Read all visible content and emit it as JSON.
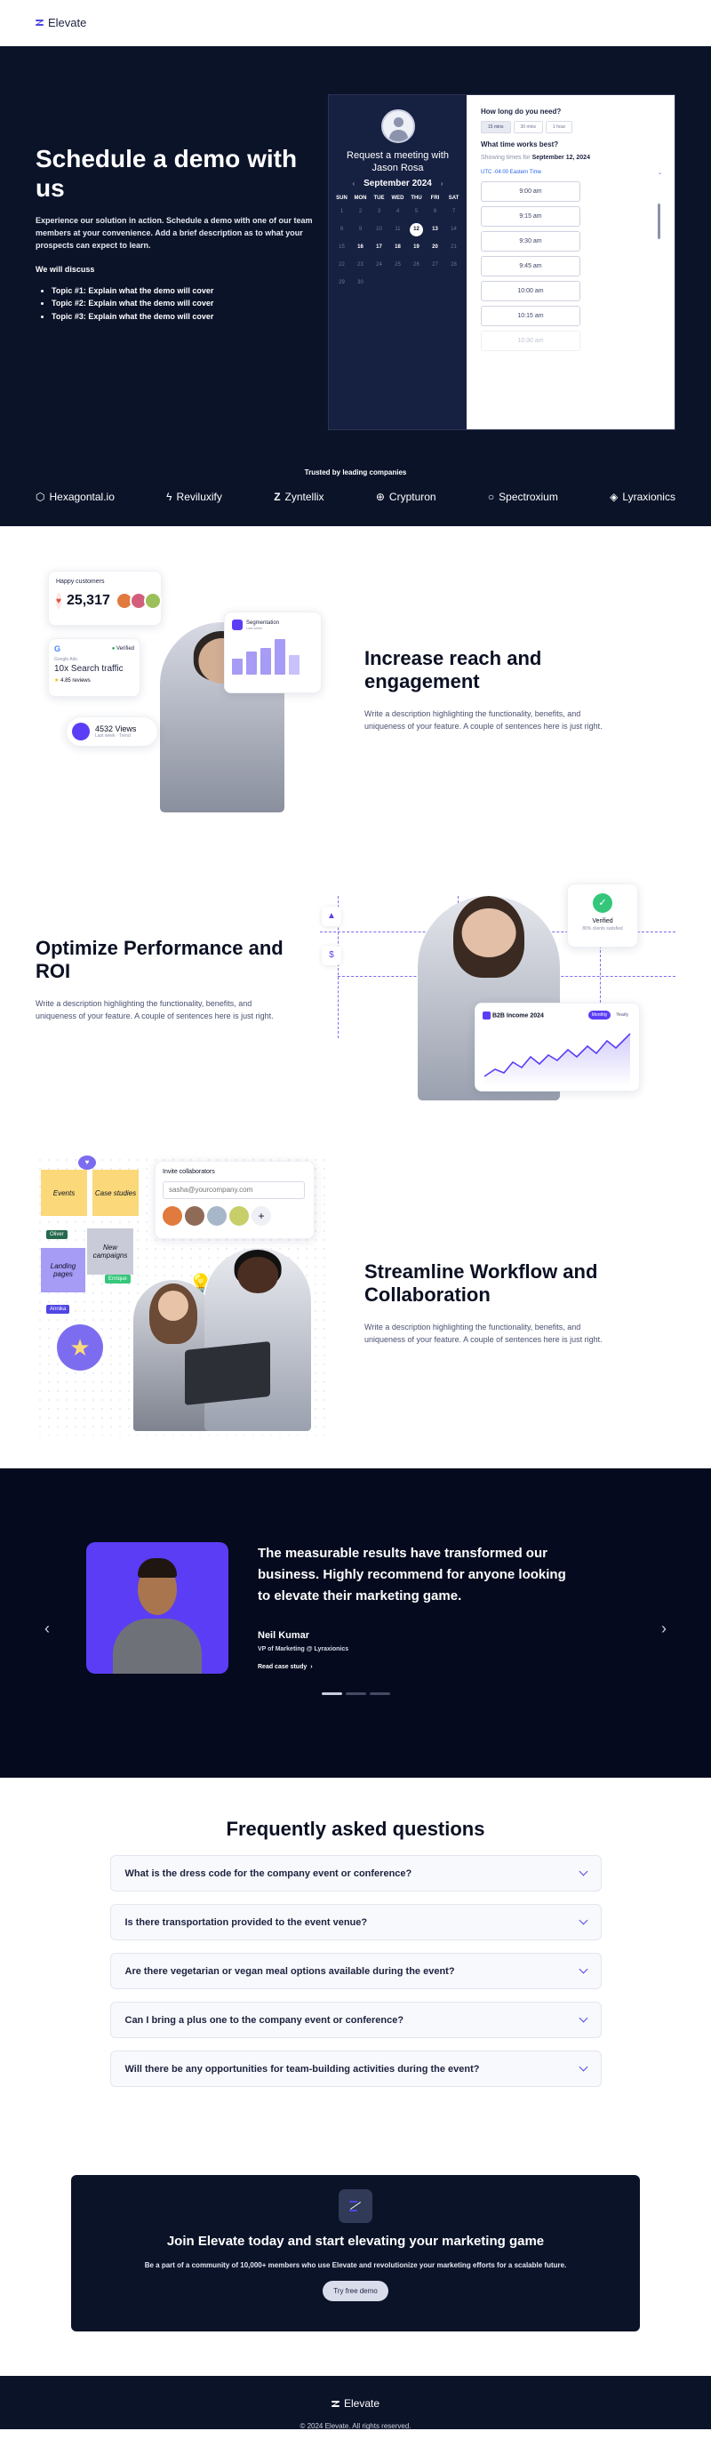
{
  "brand": {
    "name": "Elevate"
  },
  "hero": {
    "title": "Schedule a demo with us",
    "description": "Experience our solution in action. Schedule a demo with one of our team members at your convenience. Add a brief description as to what your prospects can expect to learn.",
    "discuss_heading": "We will discuss",
    "topics": [
      "Topic #1: Explain what the demo will cover",
      "Topic #2: Explain what the demo will cover",
      "Topic #3: Explain what the demo will cover"
    ]
  },
  "booking": {
    "request_title": "Request a meeting with Jason Rosa",
    "month": "September 2024",
    "weekdays": [
      "SUN",
      "MON",
      "TUE",
      "WED",
      "THU",
      "FRI",
      "SAT"
    ],
    "selected_day": "12",
    "duration_question": "How long do you need?",
    "durations": [
      "15 mins",
      "30 mins",
      "1 hour"
    ],
    "time_question": "What time works best?",
    "showing_prefix": "Showing times for",
    "showing_date": "September 12, 2024",
    "timezone": "UTC -04:00 Eastern Time",
    "times": [
      "9:00 am",
      "9:15 am",
      "9:30 am",
      "9:45 am",
      "10:00 am",
      "10:15 am",
      "10:30 am"
    ]
  },
  "trusted": {
    "label": "Trusted by leading companies",
    "logos": [
      {
        "name": "Hexagontal.io",
        "icon": "hexagon-icon"
      },
      {
        "name": "Reviluxify",
        "icon": "bolt-icon"
      },
      {
        "name": "Zyntellix",
        "icon": "z-icon"
      },
      {
        "name": "Crypturon",
        "icon": "plus-circle-icon"
      },
      {
        "name": "Spectroxium",
        "icon": "ring-icon"
      },
      {
        "name": "Lyraxionics",
        "icon": "diamond-icon"
      }
    ]
  },
  "feature1": {
    "title": "Increase reach and engagement",
    "description": "Write a description highlighting the functionality, benefits, and uniqueness of your feature. A couple of sentences here is just right.",
    "happy_label": "Happy customers",
    "happy_count": "25,317",
    "segmentation_label": "Segmentation",
    "segmentation_sub": "Last week",
    "google_sub": "Google Ads",
    "verified": "Verified",
    "traffic": "10x Search traffic",
    "reviews": "4.85 reviews",
    "views": "4532 Views",
    "views_sub": "Last week · Trend"
  },
  "feature2": {
    "title": "Optimize Performance and ROI",
    "description": "Write a description highlighting the functionality, benefits, and uniqueness of your feature. A couple of sentences here is just right.",
    "verified": "Verified",
    "verified_sub": "80% clients satisfied",
    "chart_title": "B2B Income 2024",
    "tab_monthly": "Monthly",
    "tab_yearly": "Yearly"
  },
  "feature3": {
    "title": "Streamline Workflow and Collaboration",
    "description": "Write a description highlighting the functionality, benefits, and uniqueness of your feature. A couple of sentences here is just right.",
    "invite_label": "Invite collaborators",
    "invite_placeholder": "sasha@yourcompany.com",
    "notes": [
      "Events",
      "Case studies",
      "New campaigns",
      "Landing pages"
    ],
    "tags": [
      "Oliver",
      "Enrique",
      "Annika"
    ]
  },
  "testimonial": {
    "quote": "The measurable results have transformed our business. Highly recommend for anyone looking to elevate their marketing game.",
    "name": "Neil Kumar",
    "role": "VP of Marketing @ Lyraxionics",
    "link": "Read case study"
  },
  "faq": {
    "title": "Frequently asked questions",
    "items": [
      "What is the dress code for the company event or conference?",
      "Is there transportation provided to the event venue?",
      "Are there vegetarian or vegan meal options available during the event?",
      "Can I bring a plus one to the company event or conference?",
      "Will there be any opportunities for team-building activities during the event?"
    ]
  },
  "cta": {
    "title": "Join Elevate today and start elevating your marketing game",
    "description": "Be a part of a community of 10,000+ members who use Elevate and revolutionize your marketing efforts for a scalable future.",
    "button": "Try free demo"
  },
  "footer": {
    "brand": "Elevate",
    "copyright": "© 2024 Elevate. All rights reserved."
  },
  "colors": {
    "navy": "#0b1329",
    "accent": "#4f46e5",
    "purple": "#5b3df5"
  }
}
